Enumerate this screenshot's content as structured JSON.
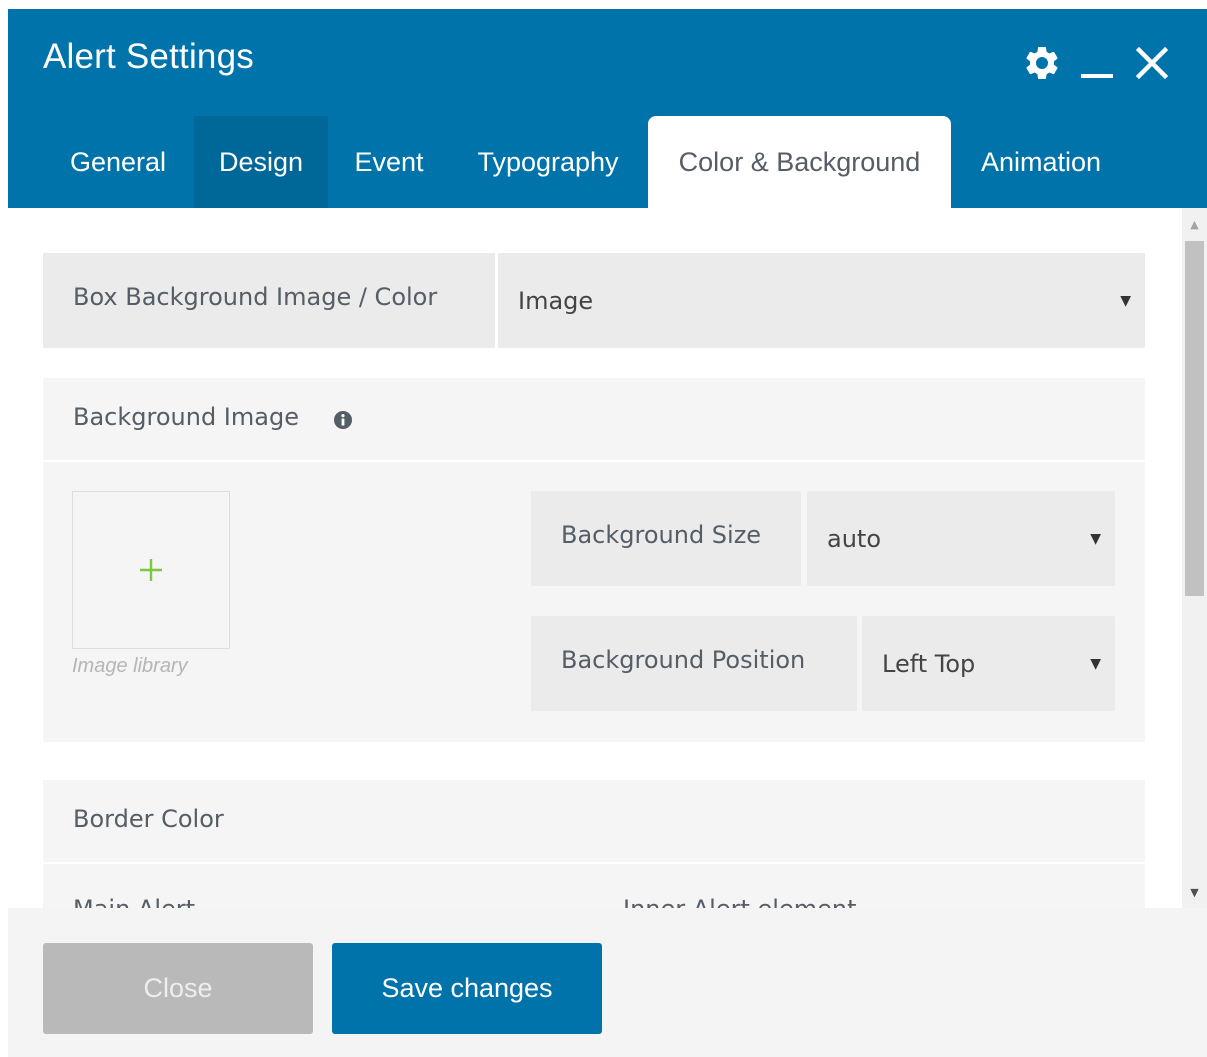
{
  "window": {
    "title": "Alert Settings",
    "icons": {
      "settings": "gear-icon",
      "minimize": "minimize-icon",
      "close": "close-icon"
    }
  },
  "tabs": [
    {
      "label": "General"
    },
    {
      "label": "Design"
    },
    {
      "label": "Event"
    },
    {
      "label": "Typography"
    },
    {
      "label": "Color & Background"
    },
    {
      "label": "Animation"
    }
  ],
  "active_tab": "Color & Background",
  "form": {
    "box_bg": {
      "label": "Box Background Image / Color",
      "value": "Image"
    },
    "bg_image": {
      "title": "Background Image",
      "info_icon": "info-icon",
      "add_icon": "plus-icon",
      "library_label": "Image library",
      "size": {
        "label": "Background Size",
        "value": "auto"
      },
      "position": {
        "label": "Background Position",
        "value": "Left Top"
      }
    },
    "border_color": {
      "title": "Border Color",
      "main_label": "Main Alert",
      "inner_label": "Inner Alert element"
    }
  },
  "footer": {
    "close_label": "Close",
    "save_label": "Save changes"
  },
  "colors": {
    "primary": "#0073aa",
    "tab_hover": "#006799",
    "plus": "#7ac943"
  }
}
